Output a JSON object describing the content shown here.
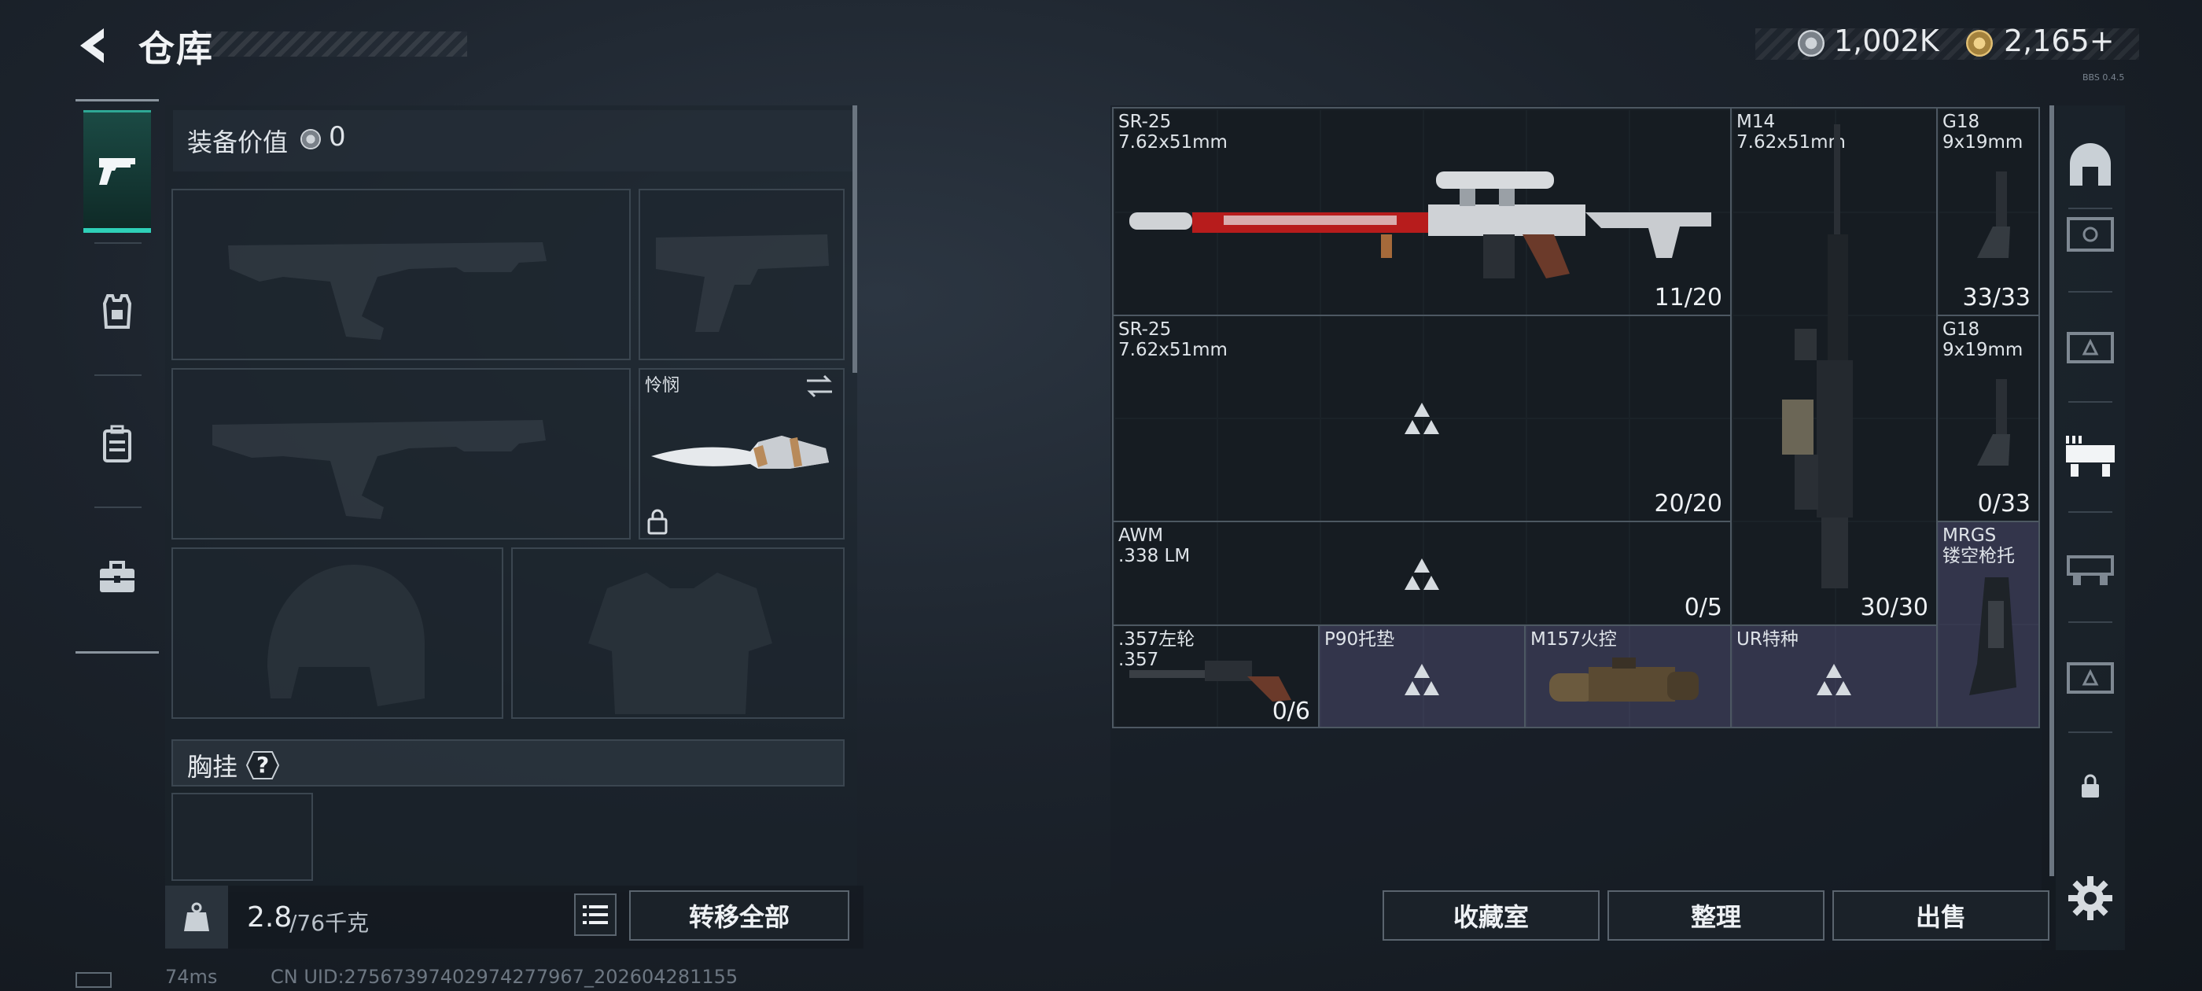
{
  "header": {
    "title": "仓库",
    "silver_amount": "1,002K",
    "gold_amount": "2,165+",
    "version": "BBS 0.4.5"
  },
  "loadout": {
    "equip_value_label": "装备价值",
    "equip_value": "0",
    "melee_name": "怜悯",
    "chest_rig_label": "胸挂",
    "chest_rig_help": "?",
    "weight_current": "2.8",
    "weight_max": "/76千克",
    "transfer_all": "转移全部"
  },
  "storage": {
    "items": [
      {
        "id": "sr25a",
        "name": "SR-25",
        "caliber": "7.62x51mm",
        "count": "11/20"
      },
      {
        "id": "sr25b",
        "name": "SR-25",
        "caliber": "7.62x51mm",
        "count": "20/20"
      },
      {
        "id": "awm",
        "name": "AWM",
        "caliber": ".338 LM",
        "count": "0/5"
      },
      {
        "id": "m14",
        "name": "M14",
        "caliber": "7.62x51mm",
        "count": "30/30"
      },
      {
        "id": "g18a",
        "name": "G18",
        "caliber": "9x19mm",
        "count": "33/33"
      },
      {
        "id": "g18b",
        "name": "G18",
        "caliber": "9x19mm",
        "count": "0/33"
      },
      {
        "id": "mrgs",
        "name": "MRGS",
        "caliber": "镂空枪托",
        "count": ""
      },
      {
        "id": "r357",
        "name": ".357左轮",
        "caliber": ".357",
        "count": "0/6"
      },
      {
        "id": "p90",
        "name": "P90托垫",
        "caliber": "",
        "count": ""
      },
      {
        "id": "m157",
        "name": "M157火控",
        "caliber": "",
        "count": ""
      },
      {
        "id": "ur",
        "name": "UR特种",
        "caliber": "",
        "count": ""
      }
    ],
    "buttons": {
      "collection": "收藏室",
      "sort": "整理",
      "sell": "出售"
    }
  },
  "status": {
    "ping": "74ms",
    "uid": "CN UID:27567397402974277967_202604281155"
  },
  "colors": {
    "accent": "#2fd0b8",
    "panel": "#1b2229",
    "rare_bg": "#383a52"
  },
  "icons": {
    "back": "back-arrow-icon",
    "silver": "silver-coin-icon",
    "gold": "gold-coin-icon",
    "weapons": "pistol-icon",
    "armor": "armor-vest-icon",
    "backpack": "backpack-icon",
    "case": "toolbox-icon",
    "settings": "gear-icon"
  }
}
